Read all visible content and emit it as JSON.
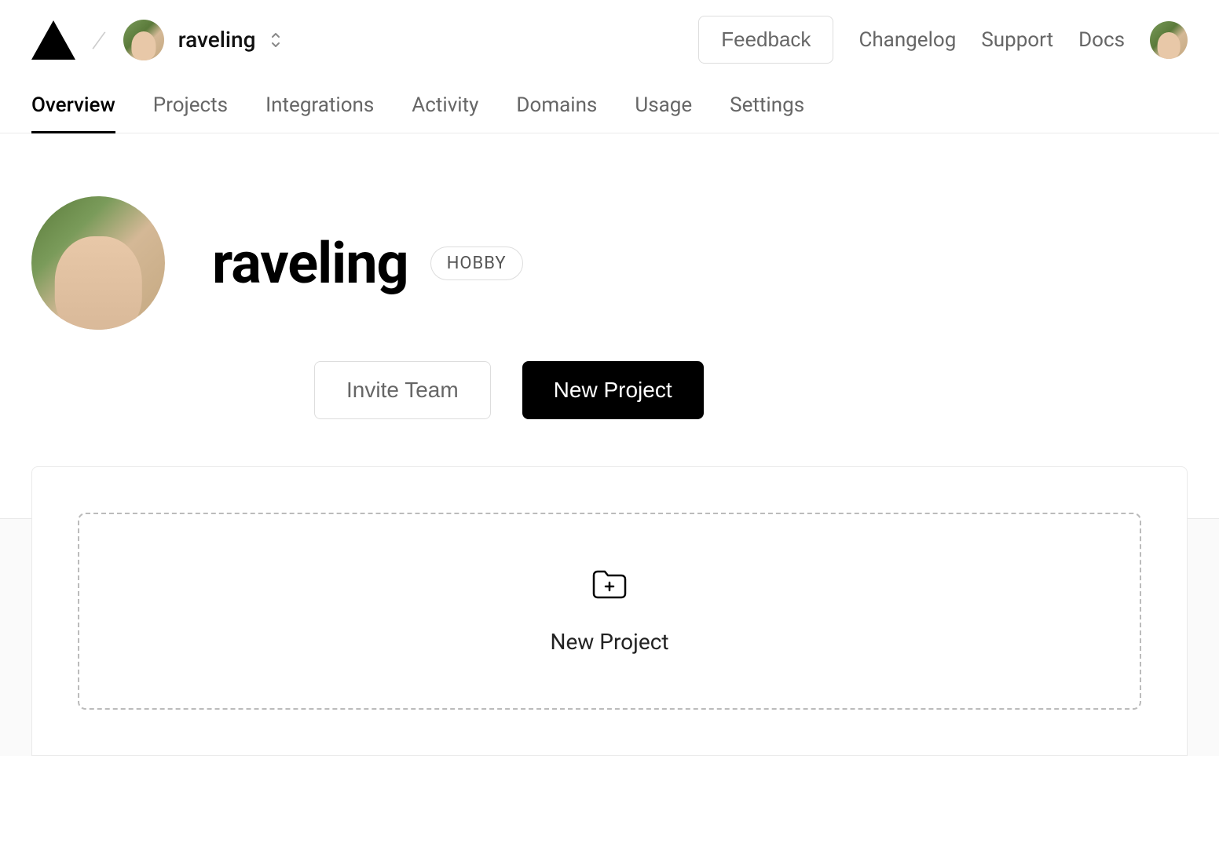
{
  "header": {
    "scope_name": "raveling",
    "feedback_label": "Feedback",
    "links": {
      "changelog": "Changelog",
      "support": "Support",
      "docs": "Docs"
    }
  },
  "tabs": {
    "overview": "Overview",
    "projects": "Projects",
    "integrations": "Integrations",
    "activity": "Activity",
    "domains": "Domains",
    "usage": "Usage",
    "settings": "Settings"
  },
  "profile": {
    "username": "raveling",
    "plan": "HOBBY"
  },
  "actions": {
    "invite_team": "Invite Team",
    "new_project": "New Project"
  },
  "empty": {
    "new_project": "New Project"
  }
}
